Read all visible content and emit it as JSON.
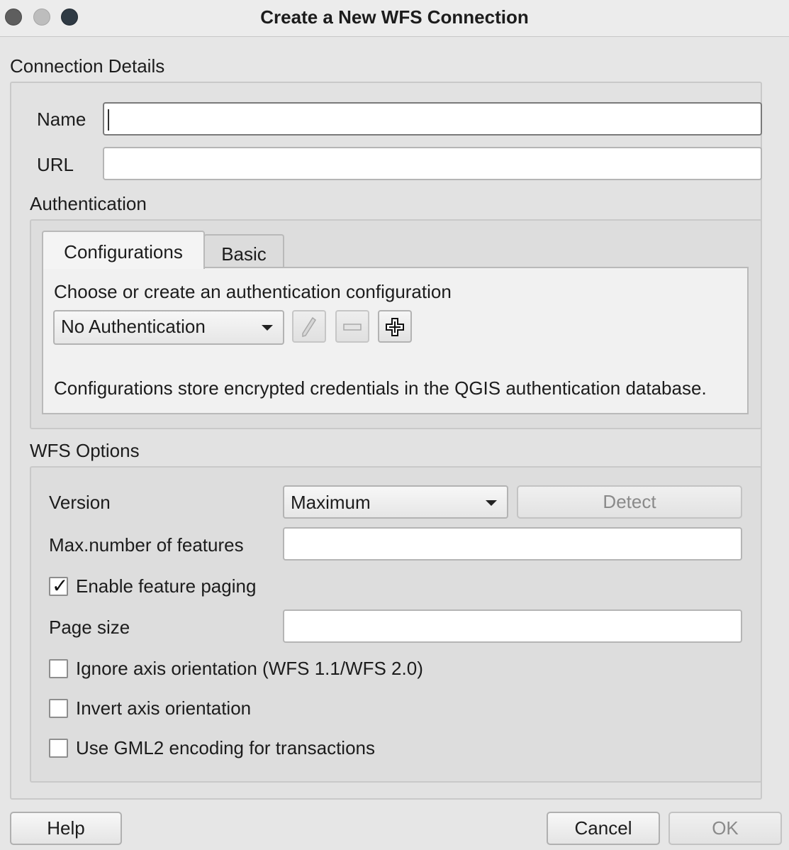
{
  "window": {
    "title": "Create a New WFS Connection"
  },
  "connection_details": {
    "section_label": "Connection Details",
    "name_label": "Name",
    "name_value": "",
    "url_label": "URL",
    "url_value": ""
  },
  "authentication": {
    "section_label": "Authentication",
    "tabs": [
      {
        "label": "Configurations",
        "active": true
      },
      {
        "label": "Basic",
        "active": false
      }
    ],
    "prompt": "Choose or create an authentication configuration",
    "config_select": "No Authentication",
    "tools": [
      {
        "icon": "pencil-icon",
        "enabled": false
      },
      {
        "icon": "minus-icon",
        "enabled": false
      },
      {
        "icon": "plus-icon",
        "enabled": true
      }
    ],
    "info": "Configurations store encrypted credentials in the QGIS authentication database."
  },
  "wfs_options": {
    "section_label": "WFS Options",
    "version_label": "Version",
    "version_value": "Maximum",
    "detect_label": "Detect",
    "max_features_label": "Max.number of features",
    "max_features_value": "",
    "enable_paging_label": "Enable feature paging",
    "enable_paging_checked": true,
    "page_size_label": "Page size",
    "page_size_value": "",
    "ignore_axis_label": "Ignore axis orientation (WFS 1.1/WFS 2.0)",
    "ignore_axis_checked": false,
    "invert_axis_label": "Invert axis orientation",
    "invert_axis_checked": false,
    "gml2_label": "Use GML2 encoding for transactions",
    "gml2_checked": false
  },
  "buttons": {
    "help": "Help",
    "cancel": "Cancel",
    "ok": "OK"
  }
}
